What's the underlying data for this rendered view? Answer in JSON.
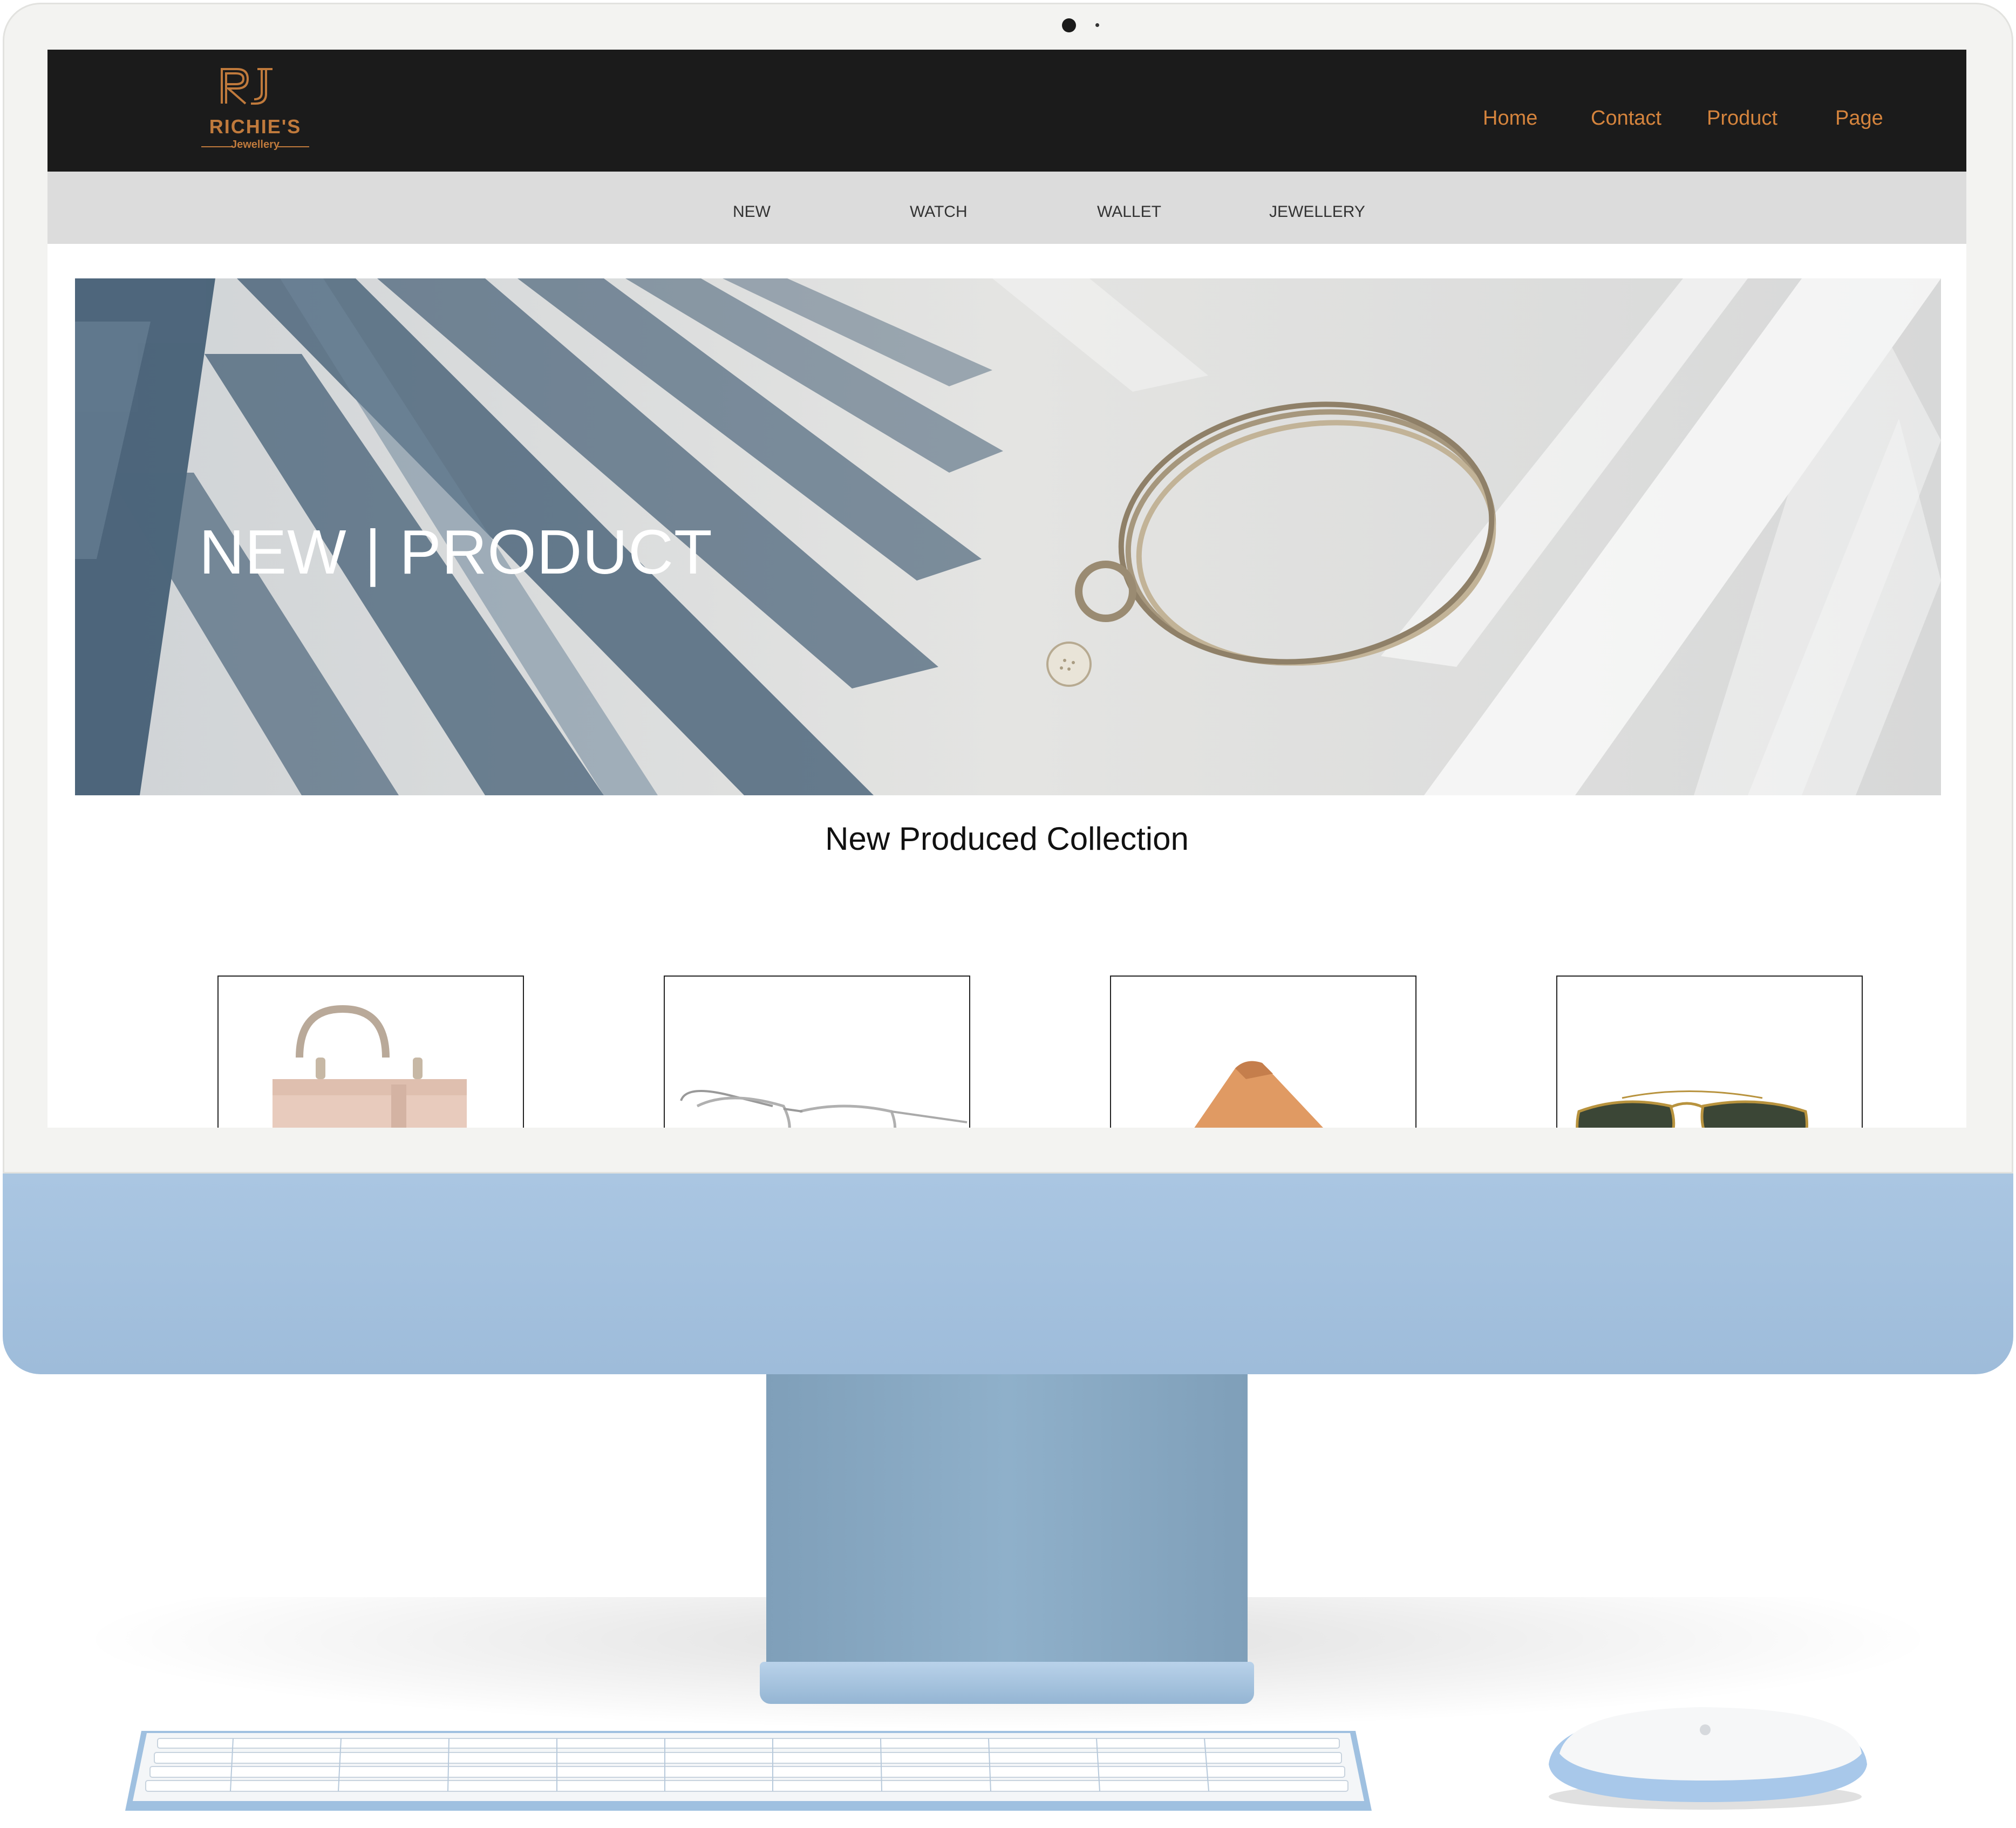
{
  "brand": {
    "monogram": "RJ",
    "name": "RICHIE'S",
    "tagline": "Jewellery",
    "accent_color": "#d5843d"
  },
  "top_nav": [
    {
      "label": "Home"
    },
    {
      "label": "Contact"
    },
    {
      "label": "Product"
    },
    {
      "label": "Page"
    }
  ],
  "category_nav": [
    {
      "label": "NEW"
    },
    {
      "label": "WATCH"
    },
    {
      "label": "WALLET"
    },
    {
      "label": "JEWELLERY"
    }
  ],
  "hero": {
    "title": "NEW | PRODUCT",
    "image": "bracelet-on-palm-leaves"
  },
  "collection": {
    "title": "New Produced Collection",
    "products": [
      {
        "image": "handbag"
      },
      {
        "image": "silver-aviator-glasses"
      },
      {
        "image": "tan-wallet"
      },
      {
        "image": "green-aviator-sunglasses"
      }
    ]
  },
  "device": {
    "frame_color": "#f3f3f1",
    "chin_color": "#a5c2e0",
    "stand_color": "#86a6c0"
  }
}
